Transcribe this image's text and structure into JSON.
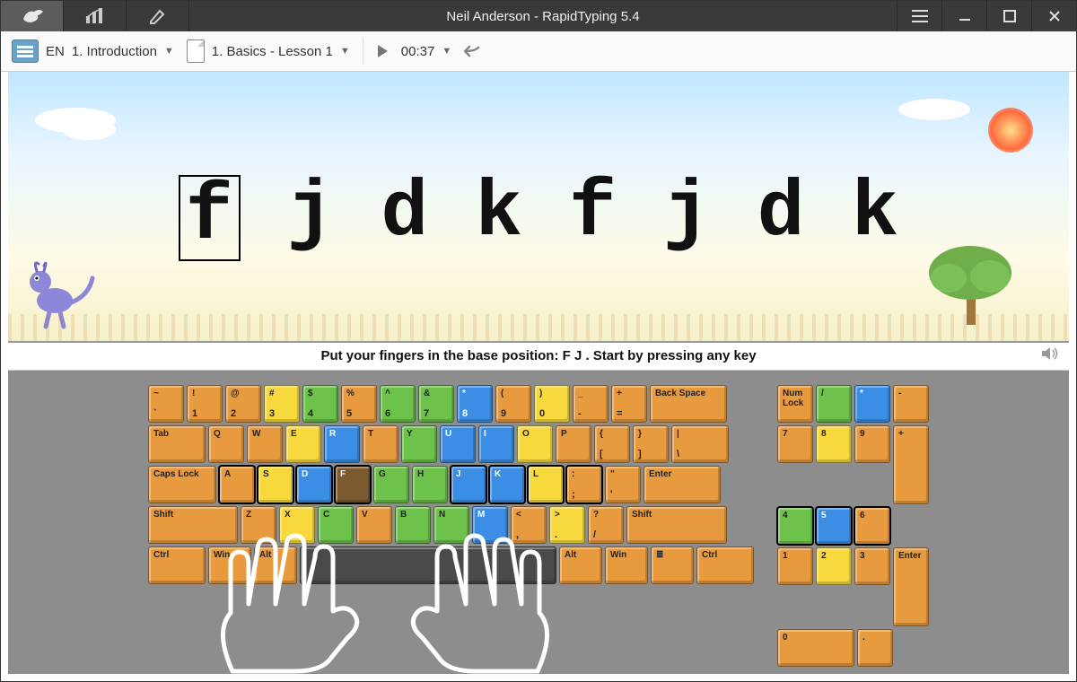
{
  "title": "Neil Anderson - RapidTyping 5.4",
  "toolbar": {
    "lang": "EN",
    "course": "1. Introduction",
    "lesson": "1. Basics - Lesson 1",
    "time": "00:37"
  },
  "lesson_letters": [
    "f",
    "j",
    "d",
    "k",
    "f",
    "j",
    "d",
    "k"
  ],
  "current_index": 0,
  "instruction": "Put your fingers in the base position:  F  J .  Start by pressing any key",
  "keyboard": {
    "rows": [
      [
        {
          "l": "~",
          "s": "`",
          "c": "or",
          "w": "w1"
        },
        {
          "l": "!",
          "s": "1",
          "c": "or",
          "w": "w1"
        },
        {
          "l": "@",
          "s": "2",
          "c": "or",
          "w": "w1"
        },
        {
          "l": "#",
          "s": "3",
          "c": "ye",
          "w": "w1"
        },
        {
          "l": "$",
          "s": "4",
          "c": "gr",
          "w": "w1"
        },
        {
          "l": "%",
          "s": "5",
          "c": "or",
          "w": "w1"
        },
        {
          "l": "^",
          "s": "6",
          "c": "gr",
          "w": "w1"
        },
        {
          "l": "&",
          "s": "7",
          "c": "gr",
          "w": "w1"
        },
        {
          "l": "*",
          "s": "8",
          "c": "bl",
          "w": "w1"
        },
        {
          "l": "(",
          "s": "9",
          "c": "or",
          "w": "w1"
        },
        {
          "l": ")",
          "s": "0",
          "c": "ye",
          "w": "w1"
        },
        {
          "l": "_",
          "s": "-",
          "c": "or",
          "w": "w1"
        },
        {
          "l": "+",
          "s": "=",
          "c": "or",
          "w": "w1"
        },
        {
          "l": "Back Space",
          "c": "or",
          "w": "w2"
        }
      ],
      [
        {
          "l": "Tab",
          "c": "or",
          "w": "w15"
        },
        {
          "l": "Q",
          "c": "or",
          "w": "w1"
        },
        {
          "l": "W",
          "c": "or",
          "w": "w1"
        },
        {
          "l": "E",
          "c": "ye",
          "w": "w1"
        },
        {
          "l": "R",
          "c": "bl",
          "w": "w1"
        },
        {
          "l": "T",
          "c": "or",
          "w": "w1"
        },
        {
          "l": "Y",
          "c": "gr",
          "w": "w1"
        },
        {
          "l": "U",
          "c": "bl",
          "w": "w1"
        },
        {
          "l": "I",
          "c": "bl",
          "w": "w1"
        },
        {
          "l": "O",
          "c": "ye",
          "w": "w1"
        },
        {
          "l": "P",
          "c": "or",
          "w": "w1"
        },
        {
          "l": "{",
          "s": "[",
          "c": "or",
          "w": "w1"
        },
        {
          "l": "}",
          "s": "]",
          "c": "or",
          "w": "w1"
        },
        {
          "l": "|",
          "s": "\\",
          "c": "or",
          "w": "w15"
        }
      ],
      [
        {
          "l": "Caps Lock",
          "c": "or",
          "w": "w17"
        },
        {
          "l": "A",
          "c": "or",
          "w": "w1",
          "home": true
        },
        {
          "l": "S",
          "c": "ye",
          "w": "w1",
          "home": true
        },
        {
          "l": "D",
          "c": "bl",
          "w": "w1",
          "home": true
        },
        {
          "l": "F",
          "c": "br",
          "w": "w1",
          "home": true
        },
        {
          "l": "G",
          "c": "gr",
          "w": "w1"
        },
        {
          "l": "H",
          "c": "gr",
          "w": "w1"
        },
        {
          "l": "J",
          "c": "bl",
          "w": "w1",
          "home": true
        },
        {
          "l": "K",
          "c": "bl",
          "w": "w1",
          "home": true
        },
        {
          "l": "L",
          "c": "ye",
          "w": "w1",
          "home": true
        },
        {
          "l": ":",
          "s": ";",
          "c": "or",
          "w": "w1",
          "home": true
        },
        {
          "l": "\"",
          "s": "'",
          "c": "or",
          "w": "w1"
        },
        {
          "l": "Enter",
          "c": "or",
          "w": "w2"
        }
      ],
      [
        {
          "l": "Shift",
          "c": "or",
          "w": "w22"
        },
        {
          "l": "Z",
          "c": "or",
          "w": "w1"
        },
        {
          "l": "X",
          "c": "ye",
          "w": "w1"
        },
        {
          "l": "C",
          "c": "gr",
          "w": "w1"
        },
        {
          "l": "V",
          "c": "or",
          "w": "w1"
        },
        {
          "l": "B",
          "c": "gr",
          "w": "w1"
        },
        {
          "l": "N",
          "c": "gr",
          "w": "w1"
        },
        {
          "l": "M",
          "c": "bl",
          "w": "w1"
        },
        {
          "l": "<",
          "s": ",",
          "c": "or",
          "w": "w1"
        },
        {
          "l": ">",
          "s": ".",
          "c": "ye",
          "w": "w1"
        },
        {
          "l": "?",
          "s": "/",
          "c": "or",
          "w": "w1"
        },
        {
          "l": "Shift",
          "c": "or",
          "w": "w25"
        }
      ],
      [
        {
          "l": "Ctrl",
          "c": "or",
          "w": "w15"
        },
        {
          "l": "Win",
          "c": "or",
          "w": "w12"
        },
        {
          "l": "Alt",
          "c": "or",
          "w": "w12"
        },
        {
          "l": "",
          "c": "dk",
          "w": "wsp"
        },
        {
          "l": "Alt",
          "c": "or",
          "w": "w12"
        },
        {
          "l": "Win",
          "c": "or",
          "w": "w12"
        },
        {
          "l": "≣",
          "c": "or",
          "w": "w12"
        },
        {
          "l": "Ctrl",
          "c": "or",
          "w": "w15"
        }
      ]
    ],
    "numpad": [
      [
        {
          "l": "Num Lock",
          "c": "or",
          "w": "w1"
        },
        {
          "l": "/",
          "c": "gr",
          "w": "w1"
        },
        {
          "l": "*",
          "c": "bl",
          "w": "w1"
        },
        {
          "l": "-",
          "c": "or",
          "w": "w1"
        }
      ],
      [
        {
          "l": "7",
          "c": "or",
          "w": "w1"
        },
        {
          "l": "8",
          "c": "ye",
          "w": "w1"
        },
        {
          "l": "9",
          "c": "or",
          "w": "w1"
        },
        {
          "l": "+",
          "c": "or",
          "w": "w1",
          "h": 2
        }
      ],
      [
        {
          "l": "4",
          "c": "gr",
          "w": "w1",
          "home": true
        },
        {
          "l": "5",
          "c": "bl",
          "w": "w1",
          "home": true
        },
        {
          "l": "6",
          "c": "or",
          "w": "w1",
          "home": true
        }
      ],
      [
        {
          "l": "1",
          "c": "or",
          "w": "w1"
        },
        {
          "l": "2",
          "c": "ye",
          "w": "w1"
        },
        {
          "l": "3",
          "c": "or",
          "w": "w1"
        },
        {
          "l": "Enter",
          "c": "or",
          "w": "w1",
          "h": 2
        }
      ],
      [
        {
          "l": "0",
          "c": "or",
          "w": "w2"
        },
        {
          "l": ".",
          "c": "or",
          "w": "w1"
        }
      ]
    ]
  }
}
